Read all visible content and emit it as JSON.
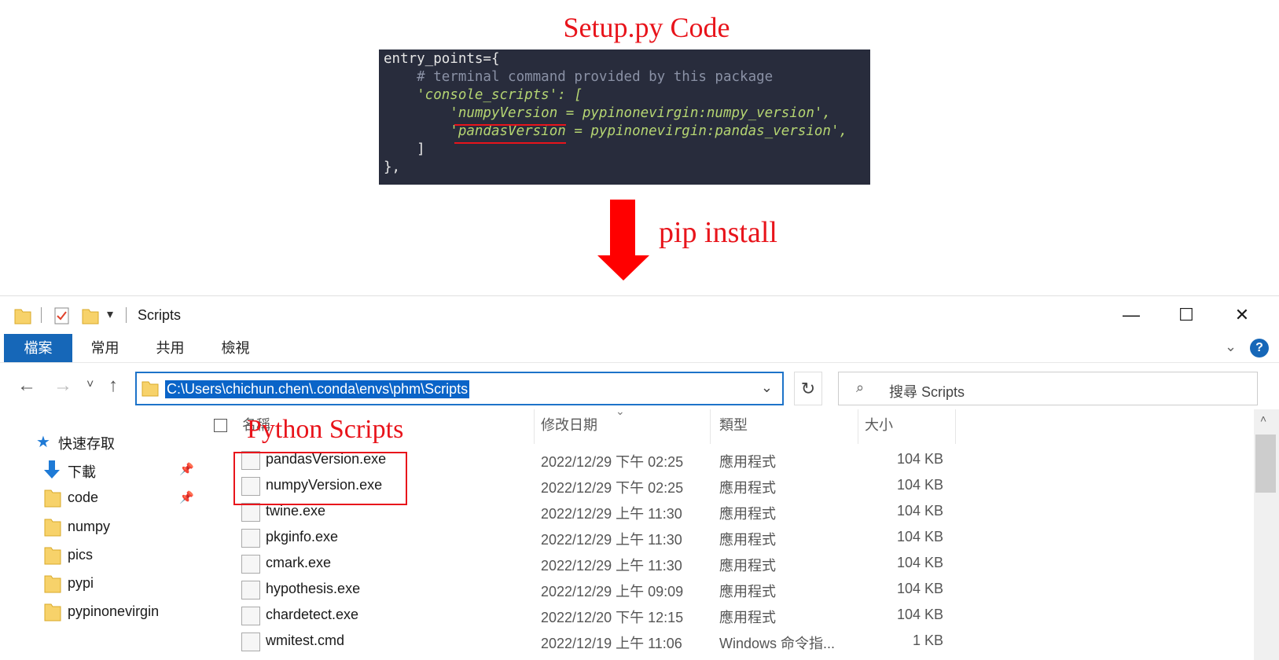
{
  "annotations": {
    "top_title": "Setup.py Code",
    "pip_label": "pip install",
    "list_label": "Python Scripts"
  },
  "code": {
    "lines": [
      {
        "t": "entry_points={",
        "cls": "c-white"
      },
      {
        "t": "    # terminal command provided by this package",
        "cls": "c-comment"
      },
      {
        "t": "    'console_scripts': [",
        "cls": "c-str"
      },
      {
        "t": "        'numpyVersion = pypinonevirgin:numpy_version',",
        "cls": "c-str"
      },
      {
        "t": "        'pandasVersion = pypinonevirgin:pandas_version',",
        "cls": "c-str"
      },
      {
        "t": "    ]",
        "cls": "c-white"
      },
      {
        "t": "},",
        "cls": "c-white"
      }
    ]
  },
  "window": {
    "title": "Scripts",
    "tabs": [
      "檔案",
      "常用",
      "共用",
      "檢視"
    ],
    "address": "C:\\Users\\chichun.chen\\.conda\\envs\\phm\\Scripts",
    "search_placeholder": "搜尋 Scripts",
    "minimize": "—",
    "maximize": "☐",
    "close": "✕"
  },
  "sidebar": {
    "items": [
      {
        "label": "快速存取",
        "icon": "star-icon",
        "pinned": false
      },
      {
        "label": "下載",
        "icon": "download-icon",
        "pinned": true
      },
      {
        "label": "code",
        "icon": "folder-icon",
        "pinned": true
      },
      {
        "label": "numpy",
        "icon": "folder-icon",
        "pinned": false
      },
      {
        "label": "pics",
        "icon": "folder-icon",
        "pinned": false
      },
      {
        "label": "pypi",
        "icon": "folder-icon",
        "pinned": false
      },
      {
        "label": "pypinonevirgin",
        "icon": "folder-icon",
        "pinned": false
      }
    ]
  },
  "columns": [
    "名稱",
    "修改日期",
    "類型",
    "大小"
  ],
  "files": [
    {
      "name": "pandasVersion.exe",
      "date": "2022/12/29 下午 02:25",
      "type": "應用程式",
      "size": "104 KB"
    },
    {
      "name": "numpyVersion.exe",
      "date": "2022/12/29 下午 02:25",
      "type": "應用程式",
      "size": "104 KB"
    },
    {
      "name": "twine.exe",
      "date": "2022/12/29 上午 11:30",
      "type": "應用程式",
      "size": "104 KB"
    },
    {
      "name": "pkginfo.exe",
      "date": "2022/12/29 上午 11:30",
      "type": "應用程式",
      "size": "104 KB"
    },
    {
      "name": "cmark.exe",
      "date": "2022/12/29 上午 11:30",
      "type": "應用程式",
      "size": "104 KB"
    },
    {
      "name": "hypothesis.exe",
      "date": "2022/12/29 上午 09:09",
      "type": "應用程式",
      "size": "104 KB"
    },
    {
      "name": "chardetect.exe",
      "date": "2022/12/20 下午 12:15",
      "type": "應用程式",
      "size": "104 KB"
    },
    {
      "name": "wmitest.cmd",
      "date": "2022/12/19 上午 11:06",
      "type": "Windows 命令指...",
      "size": "1 KB"
    }
  ],
  "colors": {
    "accent": "#1667b8",
    "annotation": "#e8141b",
    "code_bg": "#282c3c"
  }
}
